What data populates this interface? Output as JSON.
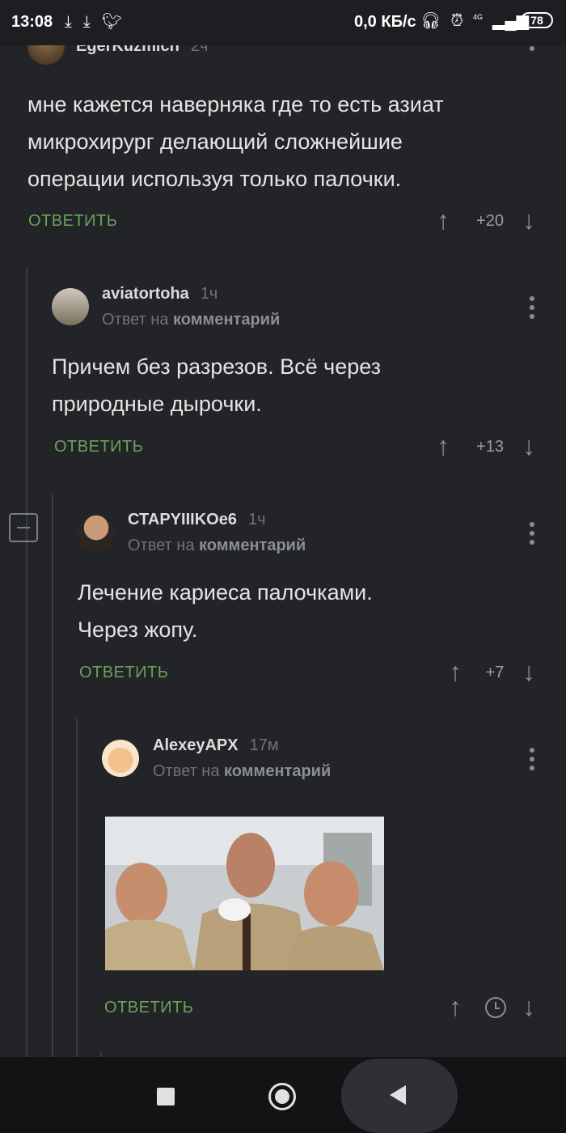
{
  "status_bar": {
    "time": "13:08",
    "left_icons": [
      "download-icon",
      "download-icon",
      "twitter-icon"
    ],
    "net_speed": "0,0 КБ/с",
    "network_label": "4G",
    "battery": "78"
  },
  "comments": [
    {
      "username": "EgerKuzmich",
      "time": "2ч",
      "text_lines": [
        "мне кажется наверняка где то есть азиат",
        "микрохирург делающий сложнейшие",
        "операции используя только палочки."
      ],
      "reply_label": "ОТВЕТИТЬ",
      "rating": "+20"
    },
    {
      "username": "aviatortoha",
      "time": "1ч",
      "reply_prefix": "Ответ на",
      "reply_target": "комментарий",
      "text_lines": [
        "Причем без разрезов. Всё через",
        "природные дырочки."
      ],
      "reply_label": "ОТВЕТИТЬ",
      "rating": "+13"
    },
    {
      "username": "СТАРYIIIKOе6",
      "time": "1ч",
      "reply_prefix": "Ответ на",
      "reply_target": "комментарий",
      "text_lines": [
        "Лечение кариеса палочками.",
        "Через жопу."
      ],
      "reply_label": "ОТВЕТИТЬ",
      "rating": "+7"
    },
    {
      "username": "AlexeyAPX",
      "time": "17м",
      "reply_prefix": "Ответ на",
      "reply_target": "комментарий",
      "reply_label": "ОТВЕТИТЬ"
    }
  ],
  "nav_bar": {
    "icons": [
      "recents-square-icon",
      "home-circle-icon",
      "back-triangle-icon"
    ]
  }
}
